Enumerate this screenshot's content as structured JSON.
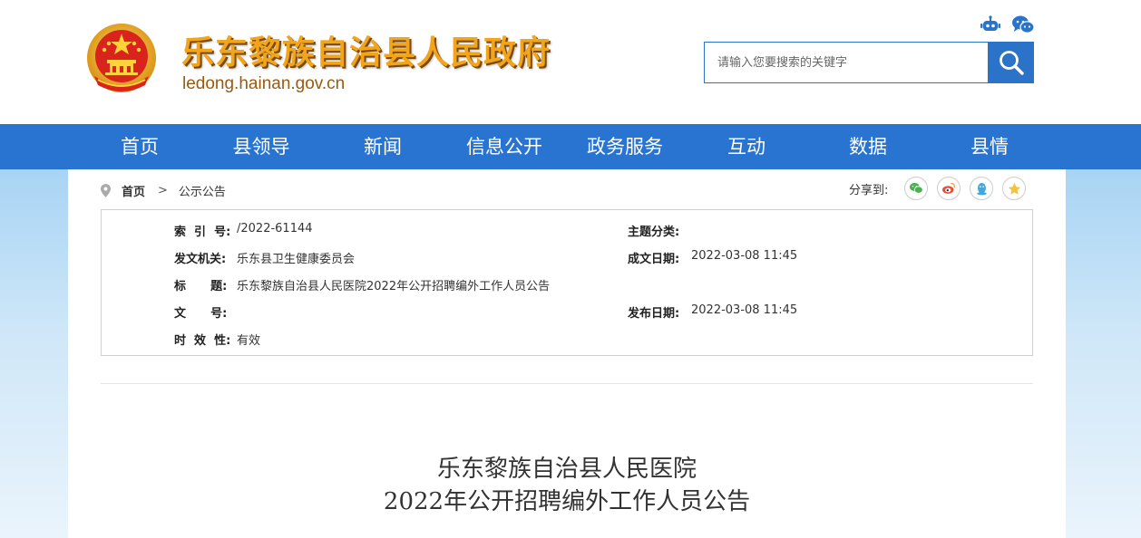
{
  "header": {
    "title": "乐东黎族自治县人民政府",
    "domain": "ledong.hainan.gov.cn",
    "icons": [
      "robot-icon",
      "wechat-icon"
    ],
    "search": {
      "placeholder": "请输入您要搜索的关键字",
      "value": ""
    }
  },
  "nav": {
    "items": [
      {
        "label": "首页"
      },
      {
        "label": "县领导"
      },
      {
        "label": "新闻"
      },
      {
        "label": "信息公开"
      },
      {
        "label": "政务服务"
      },
      {
        "label": "互动"
      },
      {
        "label": "数据"
      },
      {
        "label": "县情"
      }
    ]
  },
  "breadcrumb": {
    "home": "首页",
    "separator": ">",
    "current": "公示公告"
  },
  "share": {
    "label": "分享到:",
    "targets": [
      "wechat-icon",
      "weibo-icon",
      "qq-icon",
      "qzone-icon"
    ]
  },
  "meta": {
    "index_label": "索  引  号:",
    "index_value": "/2022-61144",
    "topic_label": "主题分类:",
    "topic_value": "",
    "issuer_label": "发文机关:",
    "issuer_value": "乐东县卫生健康委员会",
    "created_label": "成文日期:",
    "created_value": "2022-03-08 11:45",
    "title_label": "标      题:",
    "title_value": "乐东黎族自治县人民医院2022年公开招聘编外工作人员公告",
    "doc_label": "文      号:",
    "doc_value": "",
    "published_label": "发布日期:",
    "published_value": "2022-03-08 11:45",
    "validity_label": "时  效  性:",
    "validity_value": "有效"
  },
  "article": {
    "title_line1": "乐东黎族自治县人民医院",
    "title_line2": "2022年公开招聘编外工作人员公告"
  },
  "colors": {
    "nav_bg": "#2a74d1",
    "title_gold": "#f2a51b",
    "domain_brown": "#9a5a10",
    "page_bg_top": "#a8d4f4"
  }
}
